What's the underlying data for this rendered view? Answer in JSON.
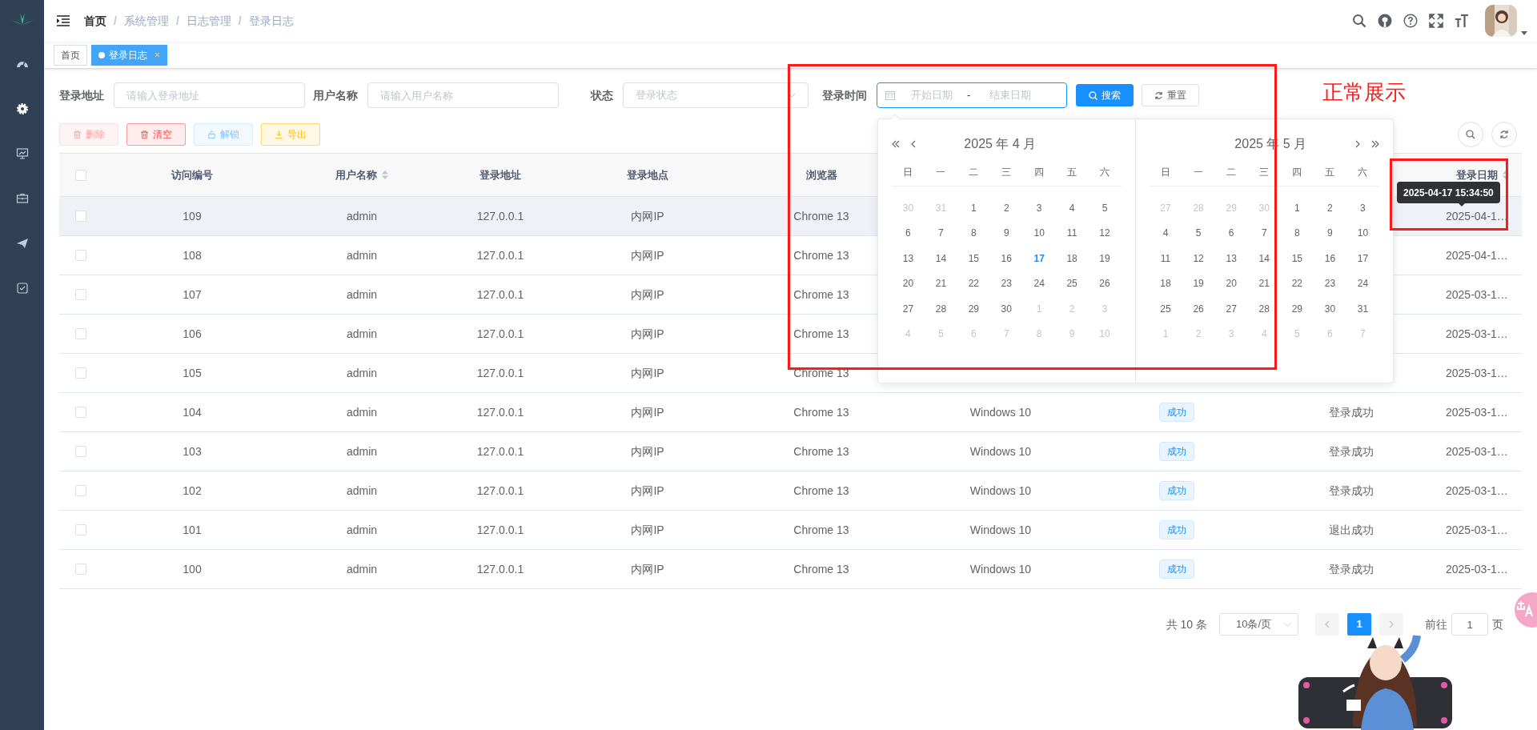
{
  "breadcrumb": [
    {
      "label": "首页",
      "kind": "link"
    },
    {
      "label": "系统管理",
      "kind": "plain",
      "separator": "/"
    },
    {
      "label": "日志管理",
      "kind": "plain",
      "separator": "/"
    },
    {
      "label": "登录日志",
      "kind": "plain",
      "separator": "/"
    }
  ],
  "tags": [
    {
      "label": "首页",
      "selected": false,
      "closable": false
    },
    {
      "label": "登录日志",
      "selected": true,
      "closable": true
    }
  ],
  "filters": [
    {
      "kind": "input",
      "label": "登录地址",
      "placeholder": "请输入登录地址"
    },
    {
      "kind": "input",
      "label": "用户名称",
      "placeholder": "请输入用户名称"
    },
    {
      "kind": "select",
      "label": "状态",
      "placeholder": "登录状态"
    },
    {
      "kind": "daterange",
      "label": "登录时间",
      "start_placeholder": "开始日期",
      "separator": "-",
      "end_placeholder": "结束日期",
      "focused": true
    }
  ],
  "filter_buttons": [
    {
      "kind": "search",
      "label": "搜索"
    },
    {
      "kind": "reset",
      "label": "重置"
    }
  ],
  "toolbar": [
    {
      "kind": "delete",
      "label": "删除",
      "disabled": true
    },
    {
      "kind": "clear",
      "label": "清空",
      "disabled": false
    },
    {
      "kind": "unlock",
      "label": "解锁",
      "disabled": true
    },
    {
      "kind": "export",
      "label": "导出",
      "disabled": false
    }
  ],
  "table": {
    "all_checked": false,
    "columns": [
      {
        "label": "访问编号",
        "sortable": false
      },
      {
        "label": "用户名称",
        "sortable": true
      },
      {
        "label": "登录地址",
        "sortable": false
      },
      {
        "label": "登录地点",
        "sortable": false
      },
      {
        "label": "浏览器",
        "sortable": false
      },
      null,
      null,
      null,
      {
        "label": "登录日期",
        "sortable": true
      }
    ],
    "rows": [
      {
        "checked": false,
        "highlighted": true,
        "cells": [
          "109",
          "admin",
          "127.0.0.1",
          "内网IP",
          "Chrome 13",
          null,
          null,
          null,
          "2025-04-1…"
        ]
      },
      {
        "checked": false,
        "highlighted": false,
        "cells": [
          "108",
          "admin",
          "127.0.0.1",
          "内网IP",
          "Chrome 13",
          null,
          null,
          null,
          "2025-04-1…"
        ]
      },
      {
        "checked": false,
        "highlighted": false,
        "cells": [
          "107",
          "admin",
          "127.0.0.1",
          "内网IP",
          "Chrome 13",
          null,
          null,
          null,
          "2025-03-1…"
        ]
      },
      {
        "checked": false,
        "highlighted": false,
        "cells": [
          "106",
          "admin",
          "127.0.0.1",
          "内网IP",
          "Chrome 13",
          null,
          null,
          null,
          "2025-03-1…"
        ]
      },
      {
        "checked": false,
        "highlighted": false,
        "cells": [
          "105",
          "admin",
          "127.0.0.1",
          "内网IP",
          "Chrome 13",
          null,
          null,
          null,
          "2025-03-1…"
        ]
      },
      {
        "checked": false,
        "highlighted": false,
        "cells": [
          "104",
          "admin",
          "127.0.0.1",
          "内网IP",
          "Chrome 13",
          "Windows 10",
          "成功",
          "登录成功",
          "2025-03-1…"
        ]
      },
      {
        "checked": false,
        "highlighted": false,
        "cells": [
          "103",
          "admin",
          "127.0.0.1",
          "内网IP",
          "Chrome 13",
          "Windows 10",
          "成功",
          "登录成功",
          "2025-03-1…"
        ]
      },
      {
        "checked": false,
        "highlighted": false,
        "cells": [
          "102",
          "admin",
          "127.0.0.1",
          "内网IP",
          "Chrome 13",
          "Windows 10",
          "成功",
          "登录成功",
          "2025-03-1…"
        ]
      },
      {
        "checked": false,
        "highlighted": false,
        "cells": [
          "101",
          "admin",
          "127.0.0.1",
          "内网IP",
          "Chrome 13",
          "Windows 10",
          "成功",
          "退出成功",
          "2025-03-1…"
        ]
      },
      {
        "checked": false,
        "highlighted": false,
        "cells": [
          "100",
          "admin",
          "127.0.0.1",
          "内网IP",
          "Chrome 13",
          "Windows 10",
          "成功",
          "登录成功",
          "2025-03-1…"
        ]
      }
    ]
  },
  "tooltip": {
    "text": "2025-04-17 15:34:50"
  },
  "datepicker": {
    "panels": [
      {
        "title": "2025 年 4 月",
        "weekdays": [
          "日",
          "一",
          "二",
          "三",
          "四",
          "五",
          "六"
        ],
        "days": [
          {
            "day": "30",
            "kind": "muted"
          },
          {
            "day": "31",
            "kind": "muted"
          },
          {
            "day": "1",
            "kind": "normal"
          },
          {
            "day": "2",
            "kind": "normal"
          },
          {
            "day": "3",
            "kind": "normal"
          },
          {
            "day": "4",
            "kind": "normal"
          },
          {
            "day": "5",
            "kind": "normal"
          },
          {
            "day": "6",
            "kind": "normal"
          },
          {
            "day": "7",
            "kind": "normal"
          },
          {
            "day": "8",
            "kind": "normal"
          },
          {
            "day": "9",
            "kind": "normal"
          },
          {
            "day": "10",
            "kind": "normal"
          },
          {
            "day": "11",
            "kind": "normal"
          },
          {
            "day": "12",
            "kind": "normal"
          },
          {
            "day": "13",
            "kind": "normal"
          },
          {
            "day": "14",
            "kind": "normal"
          },
          {
            "day": "15",
            "kind": "normal"
          },
          {
            "day": "16",
            "kind": "normal"
          },
          {
            "day": "17",
            "kind": "today"
          },
          {
            "day": "18",
            "kind": "normal"
          },
          {
            "day": "19",
            "kind": "normal"
          },
          {
            "day": "20",
            "kind": "normal"
          },
          {
            "day": "21",
            "kind": "normal"
          },
          {
            "day": "22",
            "kind": "normal"
          },
          {
            "day": "23",
            "kind": "normal"
          },
          {
            "day": "24",
            "kind": "normal"
          },
          {
            "day": "25",
            "kind": "normal"
          },
          {
            "day": "26",
            "kind": "normal"
          },
          {
            "day": "27",
            "kind": "normal"
          },
          {
            "day": "28",
            "kind": "normal"
          },
          {
            "day": "29",
            "kind": "normal"
          },
          {
            "day": "30",
            "kind": "normal"
          },
          {
            "day": "1",
            "kind": "muted"
          },
          {
            "day": "2",
            "kind": "muted"
          },
          {
            "day": "3",
            "kind": "muted"
          },
          {
            "day": "4",
            "kind": "muted"
          },
          {
            "day": "5",
            "kind": "muted"
          },
          {
            "day": "6",
            "kind": "muted"
          },
          {
            "day": "7",
            "kind": "muted"
          },
          {
            "day": "8",
            "kind": "muted"
          },
          {
            "day": "9",
            "kind": "muted"
          },
          {
            "day": "10",
            "kind": "muted"
          }
        ]
      },
      {
        "title": "2025 年 5 月",
        "weekdays": [
          "日",
          "一",
          "二",
          "三",
          "四",
          "五",
          "六"
        ],
        "days": [
          {
            "day": "27",
            "kind": "muted"
          },
          {
            "day": "28",
            "kind": "muted"
          },
          {
            "day": "29",
            "kind": "muted"
          },
          {
            "day": "30",
            "kind": "muted"
          },
          {
            "day": "1",
            "kind": "normal"
          },
          {
            "day": "2",
            "kind": "normal"
          },
          {
            "day": "3",
            "kind": "normal"
          },
          {
            "day": "4",
            "kind": "normal"
          },
          {
            "day": "5",
            "kind": "normal"
          },
          {
            "day": "6",
            "kind": "normal"
          },
          {
            "day": "7",
            "kind": "normal"
          },
          {
            "day": "8",
            "kind": "normal"
          },
          {
            "day": "9",
            "kind": "normal"
          },
          {
            "day": "10",
            "kind": "normal"
          },
          {
            "day": "11",
            "kind": "normal"
          },
          {
            "day": "12",
            "kind": "normal"
          },
          {
            "day": "13",
            "kind": "normal"
          },
          {
            "day": "14",
            "kind": "normal"
          },
          {
            "day": "15",
            "kind": "normal"
          },
          {
            "day": "16",
            "kind": "normal"
          },
          {
            "day": "17",
            "kind": "normal"
          },
          {
            "day": "18",
            "kind": "normal"
          },
          {
            "day": "19",
            "kind": "normal"
          },
          {
            "day": "20",
            "kind": "normal"
          },
          {
            "day": "21",
            "kind": "normal"
          },
          {
            "day": "22",
            "kind": "normal"
          },
          {
            "day": "23",
            "kind": "normal"
          },
          {
            "day": "24",
            "kind": "normal"
          },
          {
            "day": "25",
            "kind": "normal"
          },
          {
            "day": "26",
            "kind": "normal"
          },
          {
            "day": "27",
            "kind": "normal"
          },
          {
            "day": "28",
            "kind": "normal"
          },
          {
            "day": "29",
            "kind": "normal"
          },
          {
            "day": "30",
            "kind": "normal"
          },
          {
            "day": "31",
            "kind": "normal"
          },
          {
            "day": "1",
            "kind": "muted"
          },
          {
            "day": "2",
            "kind": "muted"
          },
          {
            "day": "3",
            "kind": "muted"
          },
          {
            "day": "4",
            "kind": "muted"
          },
          {
            "day": "5",
            "kind": "muted"
          },
          {
            "day": "6",
            "kind": "muted"
          },
          {
            "day": "7",
            "kind": "muted"
          }
        ]
      }
    ]
  },
  "pagination": {
    "total": "共 10 条",
    "page_size": "10条/页",
    "pages": [
      {
        "label": "1",
        "selected": true
      }
    ],
    "goto_label": "前往",
    "goto_value": "1",
    "goto_suffix": "页"
  },
  "annotation": {
    "text": "正常展示"
  }
}
